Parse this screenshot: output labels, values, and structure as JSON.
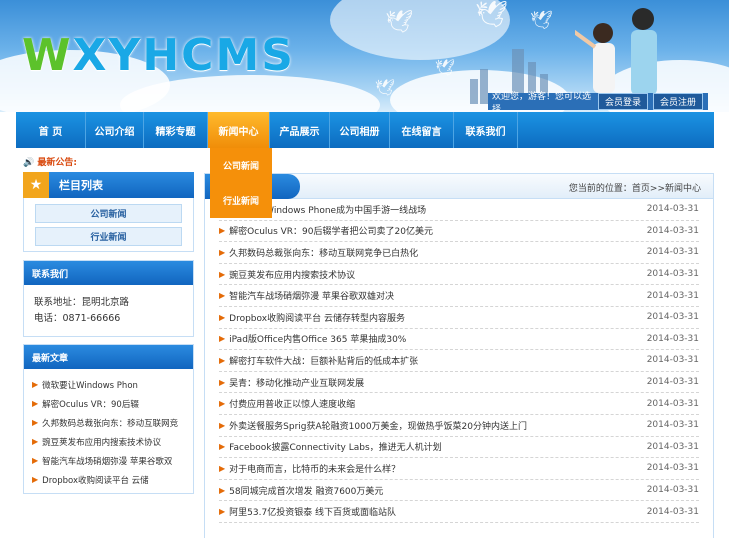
{
  "brand": {
    "logo_text": "XYHCMS"
  },
  "header": {
    "welcome": "欢迎您，游客！您可以选择",
    "login": "会员登录",
    "register": "会员注册"
  },
  "nav": {
    "items": [
      "首 页",
      "公司介绍",
      "精彩专题",
      "新闻中心",
      "产品展示",
      "公司相册",
      "在线留言",
      "联系我们"
    ],
    "active_index": 3,
    "dropdown": [
      "公司新闻",
      "行业新闻"
    ]
  },
  "notice": {
    "label": "最新公告:"
  },
  "sidebar": {
    "categories": {
      "title": "栏目列表",
      "items": [
        "公司新闻",
        "行业新闻"
      ]
    },
    "contact": {
      "title": "联系我们",
      "address": "联系地址：昆明北京路",
      "phone": "电话：0871-66666"
    },
    "latest": {
      "title": "最新文章",
      "items": [
        "微软要让Windows Phon",
        "解密Oculus VR：90后辍",
        "久邦数码总裁张向东：移动互联网竞",
        "豌豆荚发布应用内搜索技术协议",
        "智能汽车战场硝烟弥漫 苹果谷歌双",
        "Dropbox收购阅读平台 云储"
      ]
    }
  },
  "main": {
    "location": "您当前的位置：首页>>新闻中心",
    "articles": [
      {
        "title": "微软要让Windows Phone成为中国手游一线战场",
        "date": "2014-03-31"
      },
      {
        "title": "解密Oculus VR：90后辍学者把公司卖了20亿美元",
        "date": "2014-03-31"
      },
      {
        "title": "久邦数码总裁张向东：移动互联网竞争已白热化",
        "date": "2014-03-31"
      },
      {
        "title": "豌豆荚发布应用内搜索技术协议",
        "date": "2014-03-31"
      },
      {
        "title": "智能汽车战场硝烟弥漫 苹果谷歌双雄对决",
        "date": "2014-03-31"
      },
      {
        "title": "Dropbox收购阅读平台 云储存转型内容服务",
        "date": "2014-03-31"
      },
      {
        "title": "iPad版Office内售Office 365 苹果抽成30%",
        "date": "2014-03-31"
      },
      {
        "title": "解密打车软件大战：巨额补贴背后的低成本扩张",
        "date": "2014-03-31"
      },
      {
        "title": "吴青：移动化推动产业互联网发展",
        "date": "2014-03-31"
      },
      {
        "title": "付费应用普收正以惊人速度收缩",
        "date": "2014-03-31"
      },
      {
        "title": "外卖送餐服务Sprig获A轮融资1000万美金，现做热乎饭菜20分钟内送上门",
        "date": "2014-03-31"
      },
      {
        "title": "Facebook披露Connectivity Labs，推进无人机计划",
        "date": "2014-03-31"
      },
      {
        "title": "对于电商而言，比特币的未来会是什么样？",
        "date": "2014-03-31"
      },
      {
        "title": "58同城完成首次增发 融资7600万美元",
        "date": "2014-03-31"
      },
      {
        "title": "阿里53.7亿投资银泰 线下百货或面临站队",
        "date": "2014-03-31"
      }
    ]
  }
}
